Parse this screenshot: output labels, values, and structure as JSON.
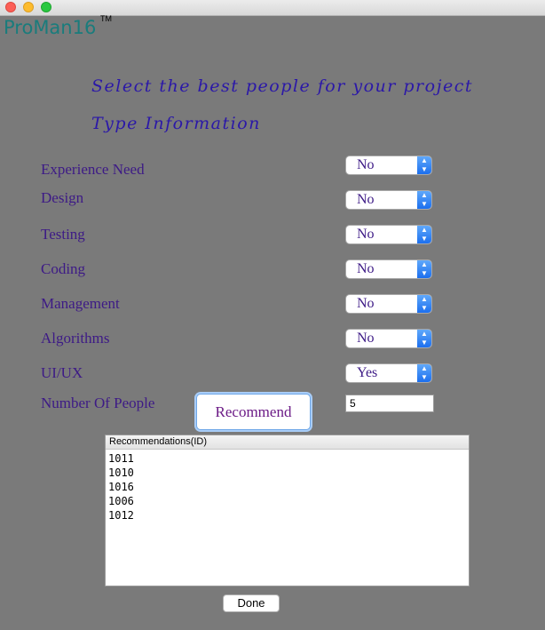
{
  "app": {
    "logo_text": "ProMan16",
    "trademark": "TM"
  },
  "headings": {
    "title": "Select the best people for your project",
    "subtitle": "Type Information"
  },
  "fields": [
    {
      "label": "Experience Need",
      "value": "No"
    },
    {
      "label": "Design",
      "value": "No"
    },
    {
      "label": "Testing",
      "value": "No"
    },
    {
      "label": "Coding",
      "value": "No"
    },
    {
      "label": "Management",
      "value": "No"
    },
    {
      "label": "Algorithms",
      "value": "No"
    },
    {
      "label": "UI/UX",
      "value": "Yes"
    }
  ],
  "people": {
    "label": "Number Of People",
    "value": "5"
  },
  "buttons": {
    "recommend": "Recommend",
    "done": "Done"
  },
  "recommendations": {
    "header": "Recommendations(ID)",
    "items": [
      "1011",
      "1010",
      "1016",
      "1006",
      "1012"
    ]
  },
  "colors": {
    "background": "#7a7a7a",
    "logo": "#1a7c7c",
    "heading": "#2b18a8",
    "label": "#3d1a86",
    "accent": "#1c6fee"
  }
}
